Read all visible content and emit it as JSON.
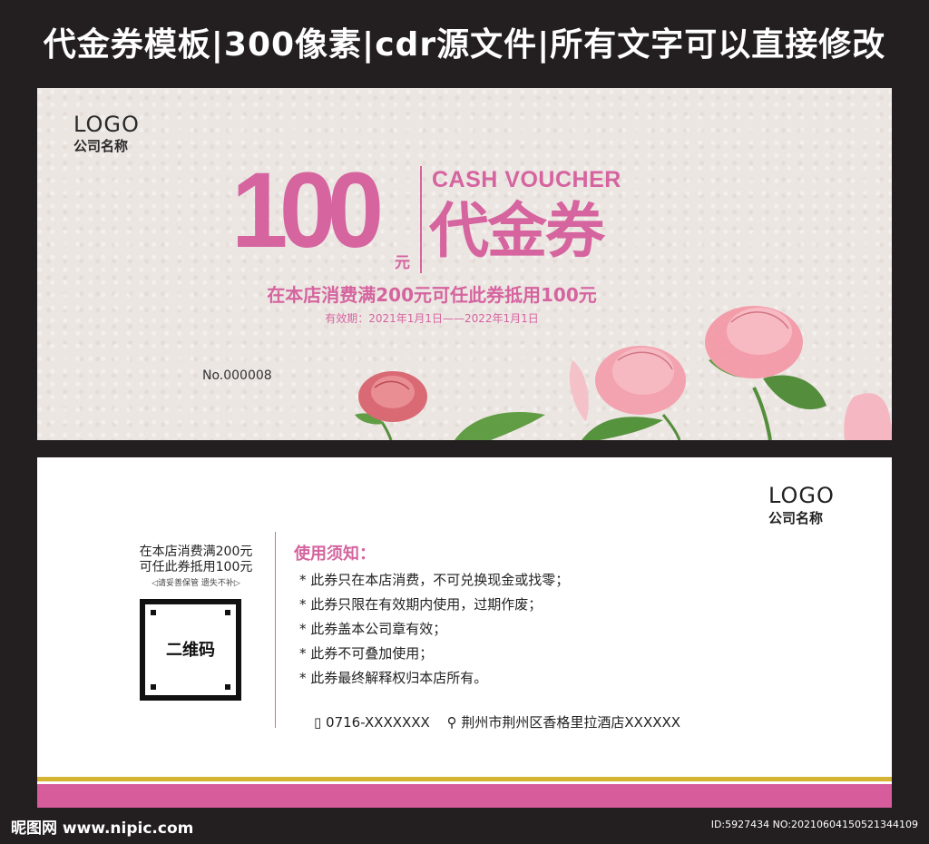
{
  "banner": {
    "title": "代金券模板|300像素|cdr源文件|所有文字可以直接修改"
  },
  "front": {
    "logo": "LOGO",
    "company": "公司名称",
    "amount": "100",
    "currency": "元",
    "cash_voucher": "CASH VOUCHER",
    "voucher_cn": "代金券",
    "description": "在本店消费满200元可任此券抵用100元",
    "validity": "有效期：2021年1月1日——2022年1月1日",
    "serial": "No.000008"
  },
  "back": {
    "logo": "LOGO",
    "company": "公司名称",
    "qr_text_1": "在本店消费满200元",
    "qr_text_2": "可任此券抵用100元",
    "qr_note": "◁请妥善保管  遗失不补▷",
    "qr_label": "二维码",
    "rules_title": "使用须知：",
    "rules": [
      "* 此券只在本店消费，不可兑换现金或找零；",
      "* 此券只限在有效期内使用，过期作废；",
      "* 此券盖本公司章有效；",
      "* 此券不可叠加使用；",
      "* 此券最终解释权归本店所有。"
    ],
    "phone": "0716-XXXXXXX",
    "address": "荆州市荆州区香格里拉酒店XXXXXX"
  },
  "watermark": {
    "left": "昵图网 www.nipic.com",
    "right": "ID:5927434 NO:20210604150521344109"
  },
  "colors": {
    "accent": "#d5649f",
    "stripe_gold": "#d4b232",
    "stripe_pink": "#d65c9c",
    "background": "#231f20"
  }
}
